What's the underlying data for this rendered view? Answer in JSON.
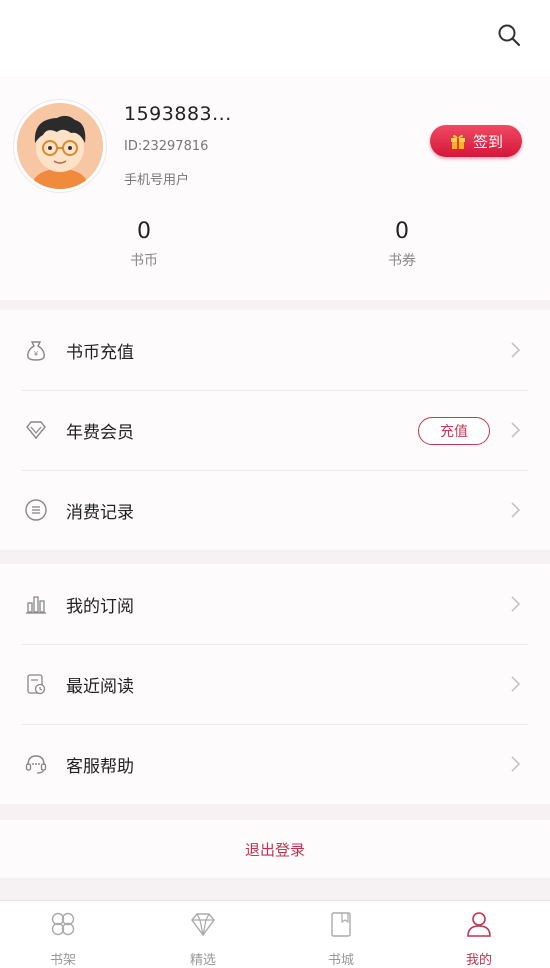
{
  "topbar": {
    "search_icon": "search-icon"
  },
  "profile": {
    "username": "1593883...",
    "user_id": "ID:23297816",
    "user_type": "手机号用户",
    "signin_label": "签到",
    "signin_icon": "gift-icon",
    "stats": [
      {
        "value": "0",
        "label": "书币"
      },
      {
        "value": "0",
        "label": "书券"
      }
    ]
  },
  "menu_group_1": [
    {
      "label": "书币充值",
      "icon": "money-bag-icon"
    },
    {
      "label": "年费会员",
      "icon": "diamond-icon",
      "badge": "充值"
    },
    {
      "label": "消费记录",
      "icon": "receipt-icon"
    }
  ],
  "menu_group_2": [
    {
      "label": "我的订阅",
      "icon": "bar-chart-icon"
    },
    {
      "label": "最近阅读",
      "icon": "clipboard-clock-icon"
    },
    {
      "label": "客服帮助",
      "icon": "headset-icon"
    }
  ],
  "logout_label": "退出登录",
  "tabs": [
    {
      "label": "书架",
      "icon": "clover-icon",
      "active": false
    },
    {
      "label": "精选",
      "icon": "gem-icon",
      "active": false
    },
    {
      "label": "书城",
      "icon": "book-icon",
      "active": false
    },
    {
      "label": "我的",
      "icon": "user-icon",
      "active": true
    }
  ],
  "colors": {
    "accent": "#c2334f",
    "signin_red": "#e0213f",
    "background": "#f6f2f4"
  }
}
